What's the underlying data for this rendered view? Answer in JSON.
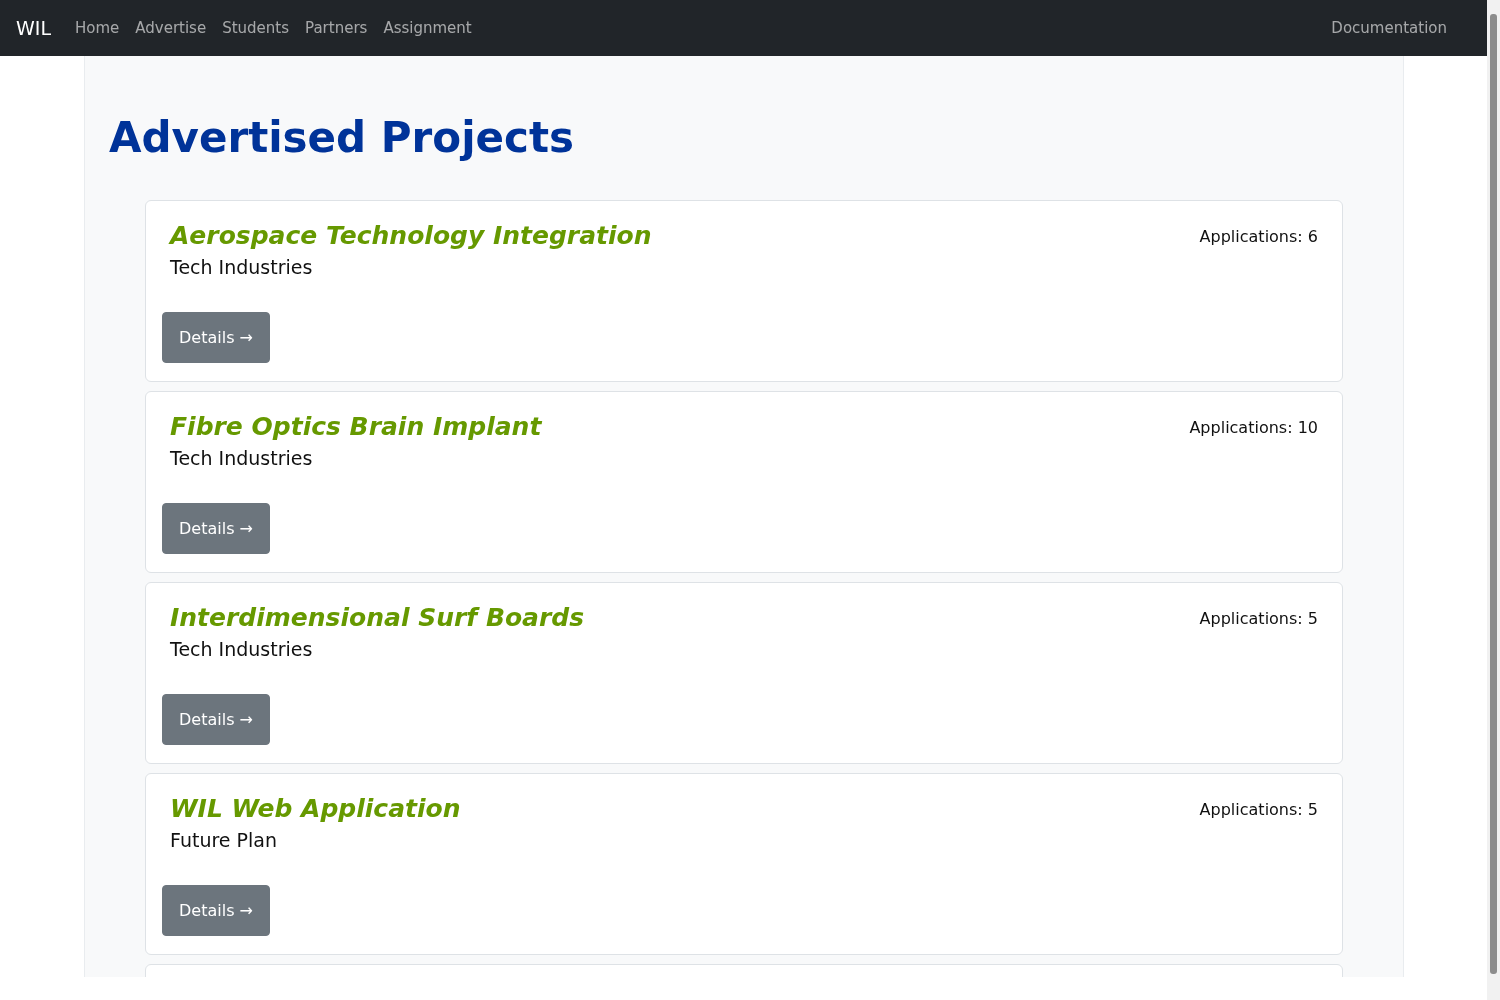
{
  "navbar": {
    "brand": "WIL",
    "links": [
      {
        "label": "Home"
      },
      {
        "label": "Advertise"
      },
      {
        "label": "Students"
      },
      {
        "label": "Partners"
      },
      {
        "label": "Assignment"
      }
    ],
    "right_link": "Documentation"
  },
  "heading": "Advertised Projects",
  "projects": [
    {
      "title": "Aerospace Technology Integration",
      "company": "Tech Industries",
      "applications": "Applications: 6",
      "button": "Details →"
    },
    {
      "title": "Fibre Optics Brain Implant",
      "company": "Tech Industries",
      "applications": "Applications: 10",
      "button": "Details →"
    },
    {
      "title": "Interdimensional Surf Boards",
      "company": "Tech Industries",
      "applications": "Applications: 5",
      "button": "Details →"
    },
    {
      "title": "WIL Web Application",
      "company": "Future Plan",
      "applications": "Applications: 5",
      "button": "Details →"
    }
  ]
}
